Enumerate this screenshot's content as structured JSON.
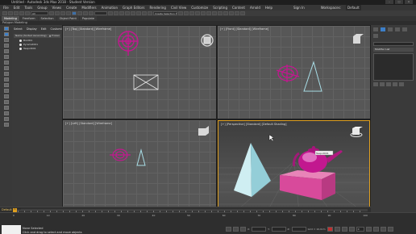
{
  "window": {
    "title": "Untitled - Autodesk 3ds Max 2018 - Student Version",
    "controls": [
      "–",
      "□",
      "×"
    ]
  },
  "menubar": {
    "items": [
      "File",
      "Edit",
      "Tools",
      "Group",
      "Views",
      "Create",
      "Modifiers",
      "Animation",
      "Graph Editors",
      "Rendering",
      "Civil View",
      "Customize",
      "Scripting",
      "Content",
      "Arnold",
      "Help"
    ],
    "sign_in": "Sign In",
    "workspaces_label": "Workspaces:",
    "workspaces_value": "Default"
  },
  "toolbar": {
    "selection_filter": "All",
    "named_selection": "Create Selection Se"
  },
  "ribbon": {
    "tabs": [
      "Modeling",
      "Freeform",
      "Selection",
      "Object Paint",
      "Populate"
    ],
    "active_tab": "Modeling",
    "sub_label": "Polygon Modeling"
  },
  "scene_explorer": {
    "tabs": [
      "Select",
      "Display",
      "Edit",
      "Customize"
    ],
    "header": "Name (Sorted Ascending)",
    "header_right": "▲ Frozen",
    "items": [
      "Box001",
      "Pyramid001",
      "Teapot001"
    ]
  },
  "viewports": {
    "top_left": "[+] [Top] [Standard] [Wireframe]",
    "top_right": "[+] [Front] [Standard] [Wireframe]",
    "bottom_left": "[+] [Left] [Standard] [Wireframe]",
    "bottom_right": "[+] [Perspective] [Standard] [Default Shading]",
    "tooltip": "Teapot001"
  },
  "command_panel": {
    "modifier_list": "Modifier List"
  },
  "timeline": {
    "label": "Default",
    "frame_counter": "0 / 100",
    "ruler_marks": [
      "0",
      "10",
      "20",
      "30",
      "40",
      "50",
      "60",
      "70",
      "80",
      "90",
      "100"
    ]
  },
  "status": {
    "line1": "None Selected",
    "line2": "Click and drag to select and move objects",
    "coords": {
      "x": "X:",
      "y": "Y:",
      "z": "Z:"
    },
    "grid": "Grid = 10,0cm",
    "add_time_tag": "Add Time Tag",
    "auto_key": "Auto Key",
    "set_key": "Set Key",
    "key_filter": "Selected",
    "frame": "0"
  },
  "colors": {
    "magenta": "#c2188f",
    "pink_box": "#d84a9b",
    "pyramid": "#a8dde6",
    "active_border": "#e0a020"
  }
}
